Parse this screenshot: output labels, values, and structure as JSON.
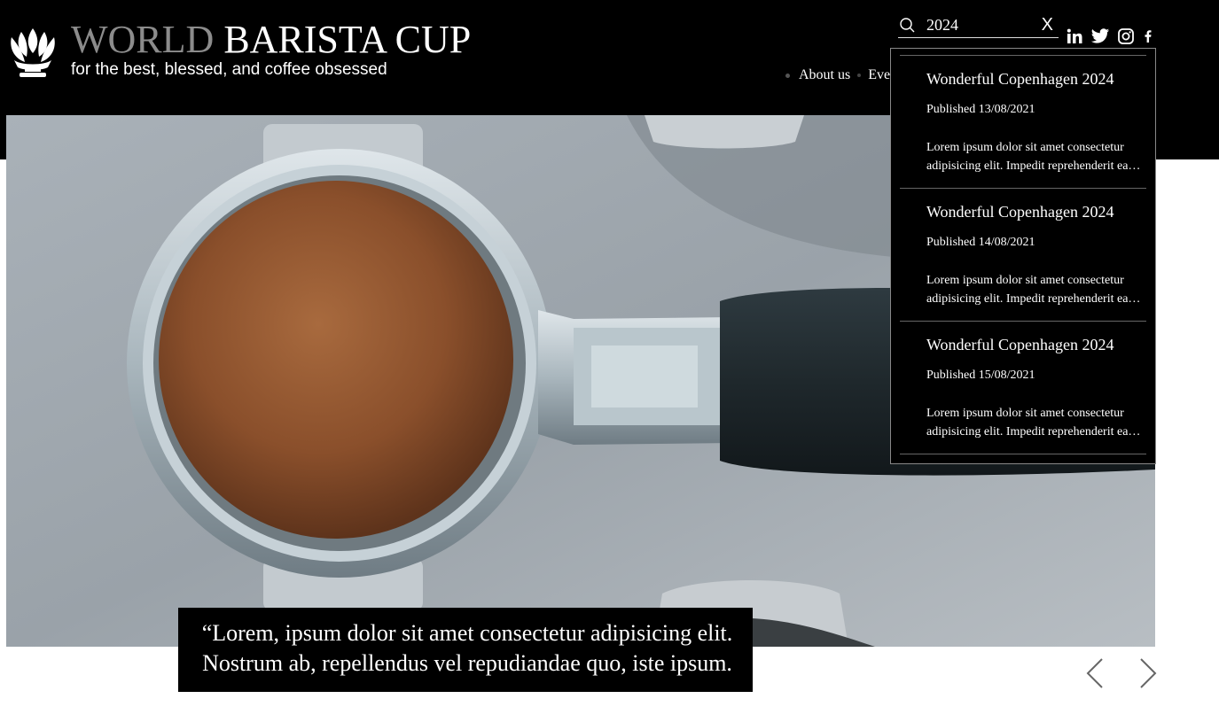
{
  "brand": {
    "title_light": "WORLD",
    "title_bold": "BARISTA CUP",
    "tagline": "for the best, blessed, and coffee obsessed",
    "logo_icon": "coffee-plant-logo-icon"
  },
  "nav": {
    "items": [
      "About us",
      "Ever"
    ]
  },
  "search": {
    "value": "2024",
    "clear_label": "X",
    "icon": "search-icon"
  },
  "socials": [
    "linkedin-icon",
    "twitter-icon",
    "instagram-icon",
    "facebook-icon"
  ],
  "results": [
    {
      "title": "Wonderful Copenhagen 2024",
      "date": "Published 13/08/2021",
      "excerpt_line1": "Lorem ipsum dolor sit amet consectetur",
      "excerpt_line2": "adipisicing elit. Impedit reprehenderit ea…"
    },
    {
      "title": "Wonderful Copenhagen 2024",
      "date": "Published 14/08/2021",
      "excerpt_line1": "Lorem ipsum dolor sit amet consectetur",
      "excerpt_line2": "adipisicing elit. Impedit reprehenderit ea…"
    },
    {
      "title": "Wonderful Copenhagen 2024",
      "date": "Published 15/08/2021",
      "excerpt_line1": "Lorem ipsum dolor sit amet consectetur",
      "excerpt_line2": "adipisicing elit. Impedit reprehenderit ea…"
    }
  ],
  "hero": {
    "quote": "“Lorem, ipsum dolor sit amet consectetur adipisicing elit. Nostrum ab, repellendus vel repudiandae quo, iste ipsum."
  },
  "colors": {
    "header_bg": "#000000",
    "brand_light": "#8c8c8c",
    "text": "#ffffff"
  }
}
